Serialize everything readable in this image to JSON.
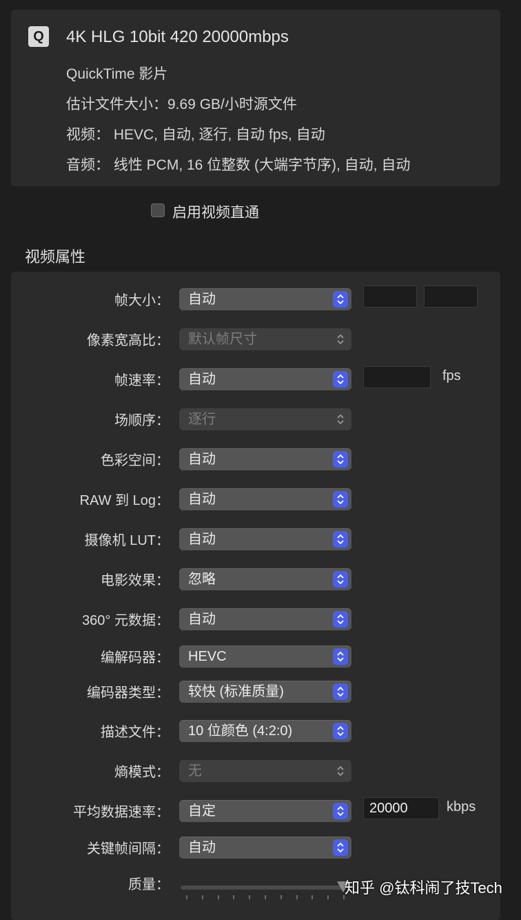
{
  "summary": {
    "title": "4K HLG 10bit 420 20000mbps",
    "format": "QuickTime 影片",
    "estimated_size": "估计文件大小：9.69 GB/小时源文件",
    "video": "视频：  HEVC, 自动, 逐行, 自动 fps, 自动",
    "audio": "音频：  线性 PCM, 16 位整数 (大端字节序), 自动, 自动"
  },
  "passthrough": {
    "label": "启用视频直通",
    "checked": false
  },
  "section_title": "视频属性",
  "rows": [
    {
      "label": "帧大小：",
      "value": "自动",
      "enabled": true
    },
    {
      "label": "像素宽高比：",
      "value": "默认帧尺寸",
      "enabled": false
    },
    {
      "label": "帧速率：",
      "value": "自动",
      "enabled": true
    },
    {
      "label": "场顺序：",
      "value": "逐行",
      "enabled": false
    },
    {
      "label": "色彩空间：",
      "value": "自动",
      "enabled": true
    },
    {
      "label": "RAW 到 Log：",
      "value": "自动",
      "enabled": true
    },
    {
      "label": "摄像机 LUT：",
      "value": "自动",
      "enabled": true
    },
    {
      "label": "电影效果：",
      "value": "忽略",
      "enabled": true
    },
    {
      "label": "360° 元数据：",
      "value": "自动",
      "enabled": true
    },
    {
      "label": "编解码器：",
      "value": "HEVC",
      "enabled": true
    },
    {
      "label": "编码器类型：",
      "value": "较快 (标准质量)",
      "enabled": true
    },
    {
      "label": "描述文件：",
      "value": "10 位颜色 (4:2:0)",
      "enabled": true
    },
    {
      "label": "熵模式：",
      "value": "无",
      "enabled": false
    },
    {
      "label": "平均数据速率：",
      "value": "自定",
      "enabled": true
    },
    {
      "label": "关键帧间隔：",
      "value": "自动",
      "enabled": true
    }
  ],
  "frame_width": "",
  "frame_height": "",
  "frame_rate_field": "",
  "fps_unit": "fps",
  "bitrate_field": "20000",
  "bitrate_unit": "kbps",
  "quality_label": "质量：",
  "quality_level": 1.0,
  "watermark": "知乎 @钛科闹了技Tech",
  "colors": {
    "accent": "#4b5fe6",
    "panel": "#2b2b2b",
    "background": "#1e1e1e"
  }
}
